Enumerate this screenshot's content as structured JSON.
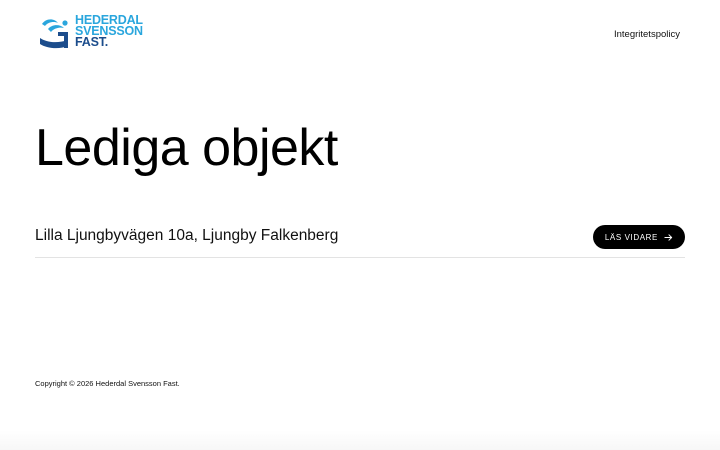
{
  "header": {
    "logo": {
      "line1": "HEDERDAL",
      "line2": "SVENSSON",
      "line3": "FAST.",
      "icon": "logo-mark-icon",
      "colors": {
        "light": "#2aa6dd",
        "dark": "#1c4d8c"
      }
    },
    "nav": {
      "privacy_label": "Integritetspolicy"
    }
  },
  "main": {
    "title": "Lediga objekt",
    "listings": [
      {
        "address": "Lilla Ljungbyvägen 10a, Ljungby Falkenberg",
        "button_label": "LÄS VIDARE",
        "button_icon": "arrow-right-icon"
      }
    ]
  },
  "footer": {
    "copyright": "Copyright © 2026 Hederdal Svensson Fast."
  }
}
